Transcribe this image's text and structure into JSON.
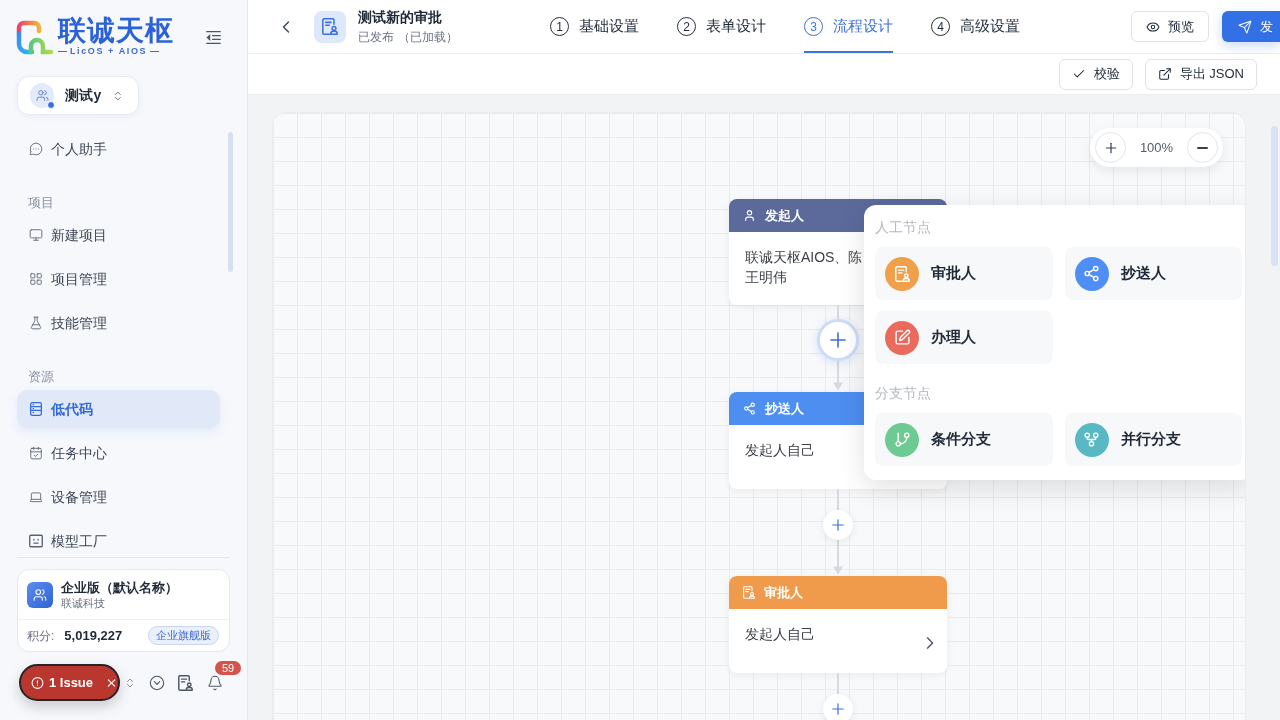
{
  "sidebar": {
    "logo": {
      "name": "联诚天枢",
      "tagline": "LicOS + AIOS"
    },
    "workspace": {
      "name": "测试y"
    },
    "nav": [
      {
        "kind": "item",
        "label": "个人助手",
        "selected": false
      },
      {
        "kind": "section",
        "label": "项目"
      },
      {
        "kind": "item",
        "label": "新建项目",
        "selected": false
      },
      {
        "kind": "item",
        "label": "项目管理",
        "selected": false
      },
      {
        "kind": "item",
        "label": "技能管理",
        "selected": false
      },
      {
        "kind": "section",
        "label": "资源"
      },
      {
        "kind": "item",
        "label": "低代码",
        "selected": true
      },
      {
        "kind": "item",
        "label": "任务中心",
        "selected": false
      },
      {
        "kind": "item",
        "label": "设备管理",
        "selected": false
      },
      {
        "kind": "item",
        "label": "模型工厂",
        "selected": false
      }
    ],
    "org_card": {
      "name": "企业版（默认名称）",
      "company": "联诚科技",
      "points_label": "积分:",
      "points": "5,019,227",
      "plan": "企业旗舰版"
    },
    "dev_bar": {
      "issue": "1 Issue",
      "notification_count": "59"
    }
  },
  "header": {
    "title": "测试新的审批",
    "status": "已发布",
    "load_state": "（已加载）",
    "steps": [
      {
        "number": "1",
        "label": "基础设置",
        "selected": false
      },
      {
        "number": "2",
        "label": "表单设计",
        "selected": false
      },
      {
        "number": "3",
        "label": "流程设计",
        "selected": true
      },
      {
        "number": "4",
        "label": "高级设置",
        "selected": false
      }
    ],
    "actions": [
      {
        "kind": "secondary",
        "label": "预览"
      },
      {
        "kind": "primary",
        "label": "发"
      }
    ]
  },
  "toolbar": {
    "buttons": [
      {
        "label": "校验"
      },
      {
        "label": "导出 JSON"
      }
    ]
  },
  "canvas": {
    "zoom": "100%",
    "nodes": [
      {
        "kind": "initiator",
        "title": "发起人",
        "color": "#5b6a9b",
        "lines": [
          "联诚天枢AIOS、陈",
          "王明伟"
        ]
      },
      {
        "kind": "cc",
        "title": "抄送人",
        "color": "#4e8ef1",
        "lines": [
          "发起人自己"
        ]
      },
      {
        "kind": "approver",
        "title": "审批人",
        "color": "#f09a4c",
        "lines": [
          "发起人自己"
        ],
        "chevron": true
      }
    ],
    "connectors": [
      {
        "selected": true
      },
      {
        "selected": false
      },
      {
        "selected": false
      }
    ],
    "add_menu": {
      "groups": [
        {
          "title": "人工节点",
          "items": [
            {
              "kind": "approver",
              "label": "审批人",
              "color": "#f0a04b"
            },
            {
              "kind": "cc",
              "label": "抄送人",
              "color": "#4f8ef7"
            },
            {
              "kind": "handler",
              "label": "办理人",
              "color": "#ea6a5e"
            }
          ]
        },
        {
          "title": "分支节点",
          "items": [
            {
              "kind": "condition",
              "label": "条件分支",
              "color": "#6dca92"
            },
            {
              "kind": "parallel",
              "label": "并行分支",
              "color": "#58b9c4"
            }
          ]
        }
      ]
    }
  }
}
